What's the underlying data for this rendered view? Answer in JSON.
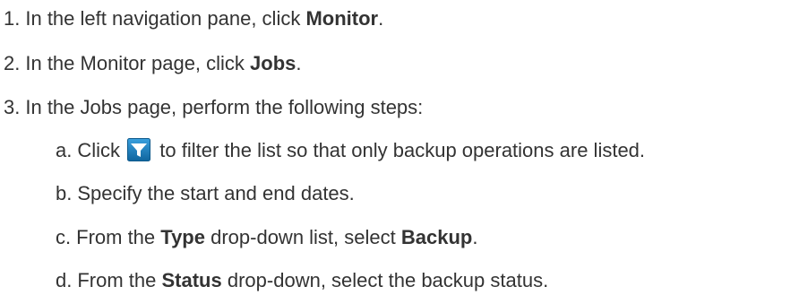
{
  "steps": [
    {
      "marker": "1.",
      "pre": "In the left navigation pane, click ",
      "bold": "Monitor",
      "post": "."
    },
    {
      "marker": "2.",
      "pre": "In the Monitor page, click ",
      "bold": "Jobs",
      "post": "."
    },
    {
      "marker": "3.",
      "text": "In the Jobs page, perform the following steps:"
    }
  ],
  "substeps": [
    {
      "marker": "a.",
      "pre": "Click",
      "icon": "filter-icon",
      "post": "to filter the list so that only backup operations are listed."
    },
    {
      "marker": "b.",
      "text": "Specify the start and end dates."
    },
    {
      "marker": "c.",
      "pre": "From the ",
      "bold1": "Type",
      "mid": " drop-down list, select ",
      "bold2": "Backup",
      "post": "."
    },
    {
      "marker": "d.",
      "pre": "From the ",
      "bold": "Status",
      "post": " drop-down, select the backup status."
    }
  ],
  "colors": {
    "text": "#333333",
    "icon_bg": "#1a7fc2",
    "icon_funnel": "#ffffff"
  }
}
